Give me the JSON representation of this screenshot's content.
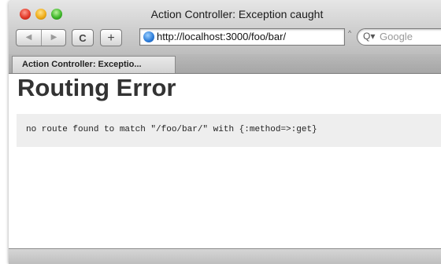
{
  "window": {
    "title": "Action Controller: Exception caught"
  },
  "toolbar": {
    "back_icon": "◀",
    "forward_icon": "▶",
    "reload_icon": "C",
    "add_icon": "+"
  },
  "address_bar": {
    "url": "http://localhost:3000/foo/bar/",
    "snapback_icon": "^"
  },
  "search": {
    "placeholder": "Google",
    "icon": "Q▾"
  },
  "tabs": [
    {
      "label": "Action Controller: Exceptio..."
    }
  ],
  "page": {
    "heading": "Routing Error",
    "message": "no route found to match \"/foo/bar/\" with {:method=>:get}"
  }
}
